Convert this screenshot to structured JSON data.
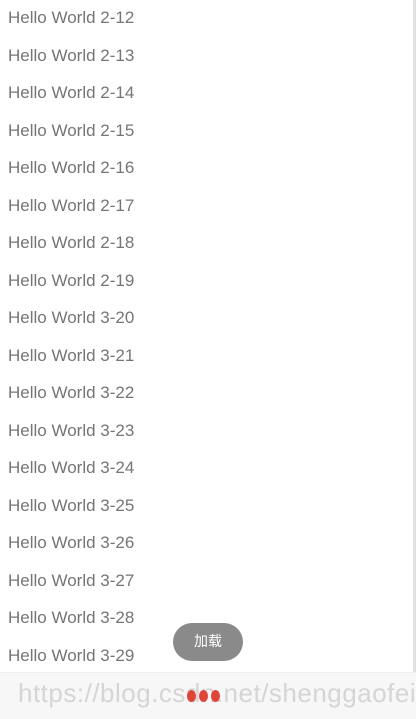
{
  "list": {
    "items": [
      "Hello World 2-12",
      "Hello World 2-13",
      "Hello World 2-14",
      "Hello World 2-15",
      "Hello World 2-16",
      "Hello World 2-17",
      "Hello World 2-18",
      "Hello World 2-19",
      "Hello World 3-20",
      "Hello World 3-21",
      "Hello World 3-22",
      "Hello World 3-23",
      "Hello World 3-24",
      "Hello World 3-25",
      "Hello World 3-26",
      "Hello World 3-27",
      "Hello World 3-28",
      "Hello World 3-29"
    ]
  },
  "toast": {
    "text": "加载"
  },
  "footer": {
    "watermark": "https://blog.csdn.net/shenggaofei",
    "loader_icon": "loading-dots-icon"
  },
  "colors": {
    "item_text": "#757575",
    "toast_bg": "#8a8a8a",
    "loader_dot": "#e0453a"
  }
}
